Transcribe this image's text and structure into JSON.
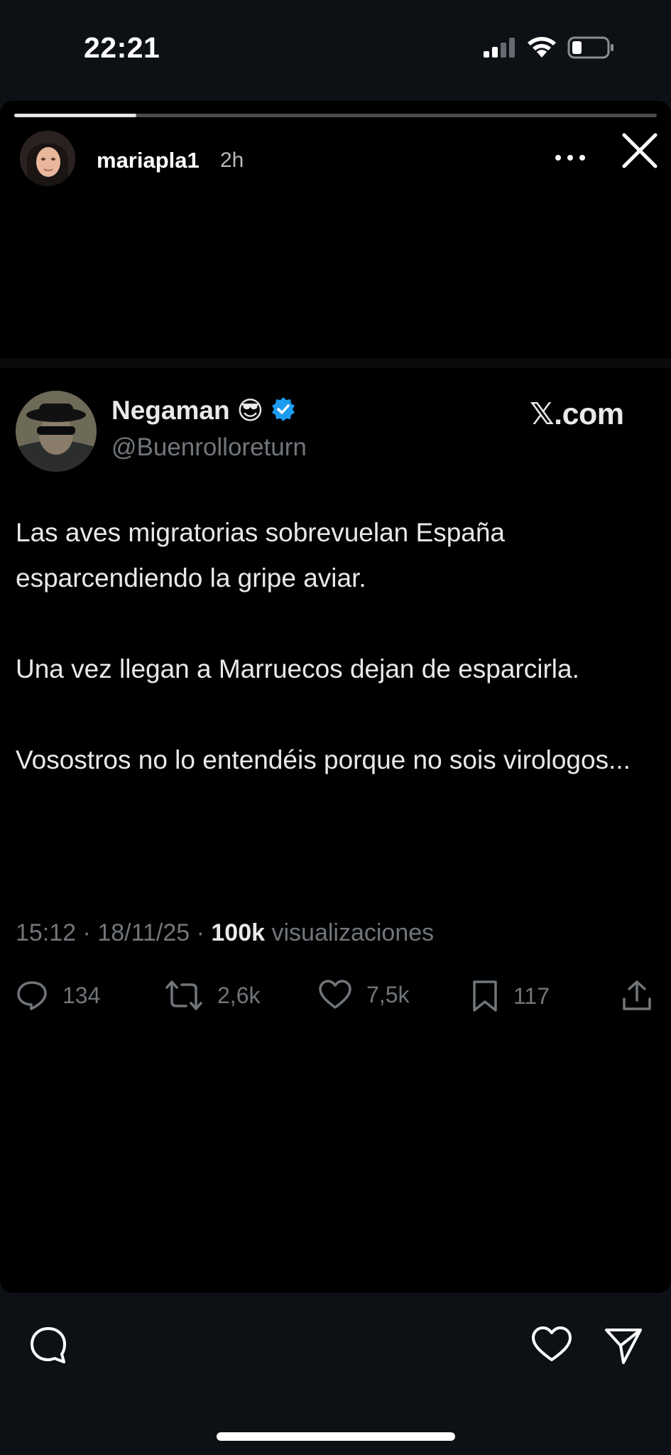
{
  "status_bar": {
    "time": "22:21"
  },
  "story": {
    "progress": 0.19,
    "username": "mariapla1",
    "time_ago": "2h"
  },
  "tweet": {
    "display_name": "Negaman",
    "emoji": "😎",
    "handle": "@Buenrolloreturn",
    "source": "𝕏.com",
    "paragraphs": [
      "Las aves migratorias sobrevuelan España esparcendiendo la gripe aviar.",
      "Una vez llegan a Marruecos dejan de esparcirla.",
      "Vosostros no lo entendéis porque no sois virologos..."
    ],
    "meta": {
      "time": "15:12",
      "sep": "·",
      "date": "18/11/25",
      "views_count": "100k",
      "views_label": "visualizaciones"
    },
    "actions": {
      "replies": "134",
      "reposts": "2,6k",
      "likes": "7,5k",
      "bookmarks": "117"
    }
  },
  "colors": {
    "verified": "#1d9bf0",
    "muted": "#71767b",
    "text": "#e7e9ea"
  }
}
